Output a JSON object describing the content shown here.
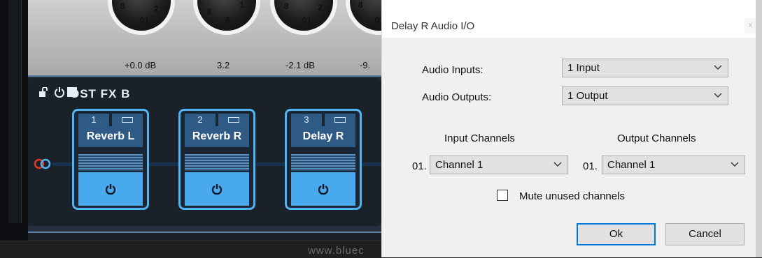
{
  "plugin": {
    "knob_values": [
      "+0.0 dB",
      "3.2",
      "-2.1 dB",
      "-9."
    ],
    "section_title": "OST FX B",
    "pedals": [
      {
        "number": "1",
        "name": "Reverb L"
      },
      {
        "number": "2",
        "name": "Reverb R"
      },
      {
        "number": "3",
        "name": "Delay R"
      }
    ],
    "footer_text": "www.bluec",
    "colors": {
      "accent": "#4fb4f2",
      "panel": "#1a2129"
    }
  },
  "dialog": {
    "title": "Delay R Audio I/O",
    "close_label": "x",
    "audio_inputs_label": "Audio Inputs:",
    "audio_inputs_value": "1 Input",
    "audio_outputs_label": "Audio Outputs:",
    "audio_outputs_value": "1 Output",
    "input_channels_header": "Input Channels",
    "output_channels_header": "Output Channels",
    "input_row_number": "01.",
    "input_channel_value": "Channel 1",
    "output_row_number": "01.",
    "output_channel_value": "Channel 1",
    "mute_label": "Mute unused channels",
    "mute_checked": false,
    "ok_label": "Ok",
    "cancel_label": "Cancel"
  }
}
